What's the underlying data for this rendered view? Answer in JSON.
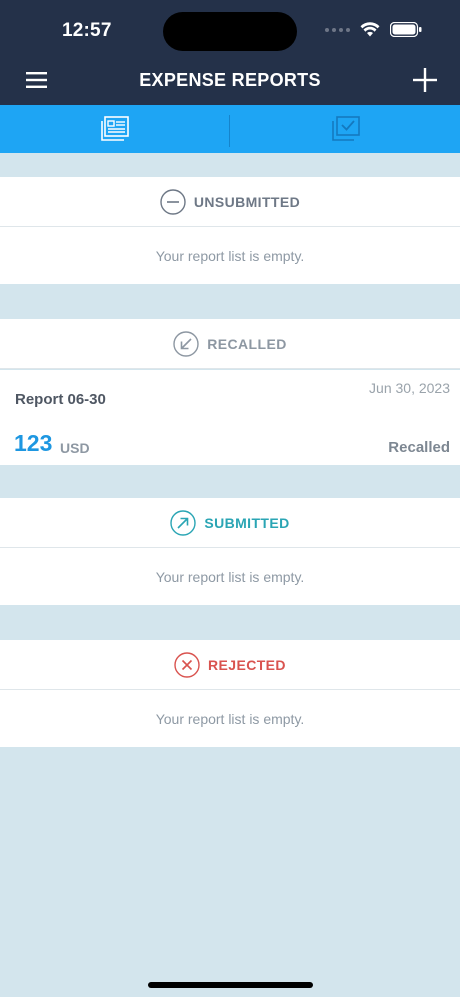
{
  "status_bar": {
    "time": "12:57"
  },
  "nav": {
    "title": "EXPENSE REPORTS"
  },
  "tabs": [
    {
      "icon": "reports-list-icon",
      "active": true
    },
    {
      "icon": "approvals-icon",
      "active": false
    }
  ],
  "sections": {
    "unsubmitted": {
      "label": "UNSUBMITTED",
      "empty_text": "Your report list is empty.",
      "color": "#6e7886"
    },
    "recalled": {
      "label": "RECALLED",
      "color": "#8d97a2"
    },
    "submitted": {
      "label": "SUBMITTED",
      "empty_text": "Your report list is empty.",
      "color": "#2aa5b4"
    },
    "rejected": {
      "label": "REJECTED",
      "empty_text": "Your report list is empty.",
      "color": "#d9534f"
    }
  },
  "report": {
    "name": "Report 06-30",
    "date": "Jun 30, 2023",
    "amount": "123",
    "currency": "USD",
    "status": "Recalled"
  }
}
